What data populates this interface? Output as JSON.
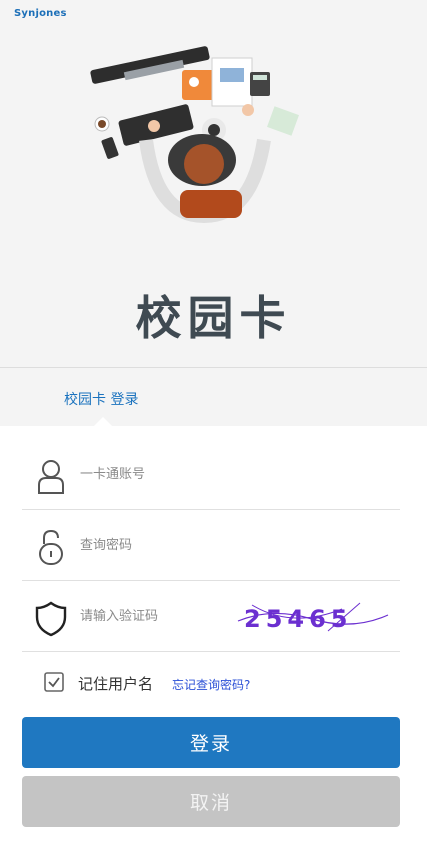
{
  "header": {
    "logo_text": "Synjones",
    "brand_title": "校园卡"
  },
  "tab": {
    "label": "校园卡 登录"
  },
  "form": {
    "account_placeholder": "一卡通账号",
    "password_placeholder": "查询密码",
    "captcha_placeholder": "请输入验证码",
    "captcha_code": "25465",
    "remember_label": "记住用户名",
    "forgot_link": "忘记查询密码?",
    "remember_checked": true
  },
  "buttons": {
    "login_label": "登录",
    "cancel_label": "取消"
  },
  "colors": {
    "accent": "#1f78c1",
    "cancel": "#c4c4c4",
    "link": "#2a4fd6",
    "captcha_ink": "#6b2fd0"
  }
}
